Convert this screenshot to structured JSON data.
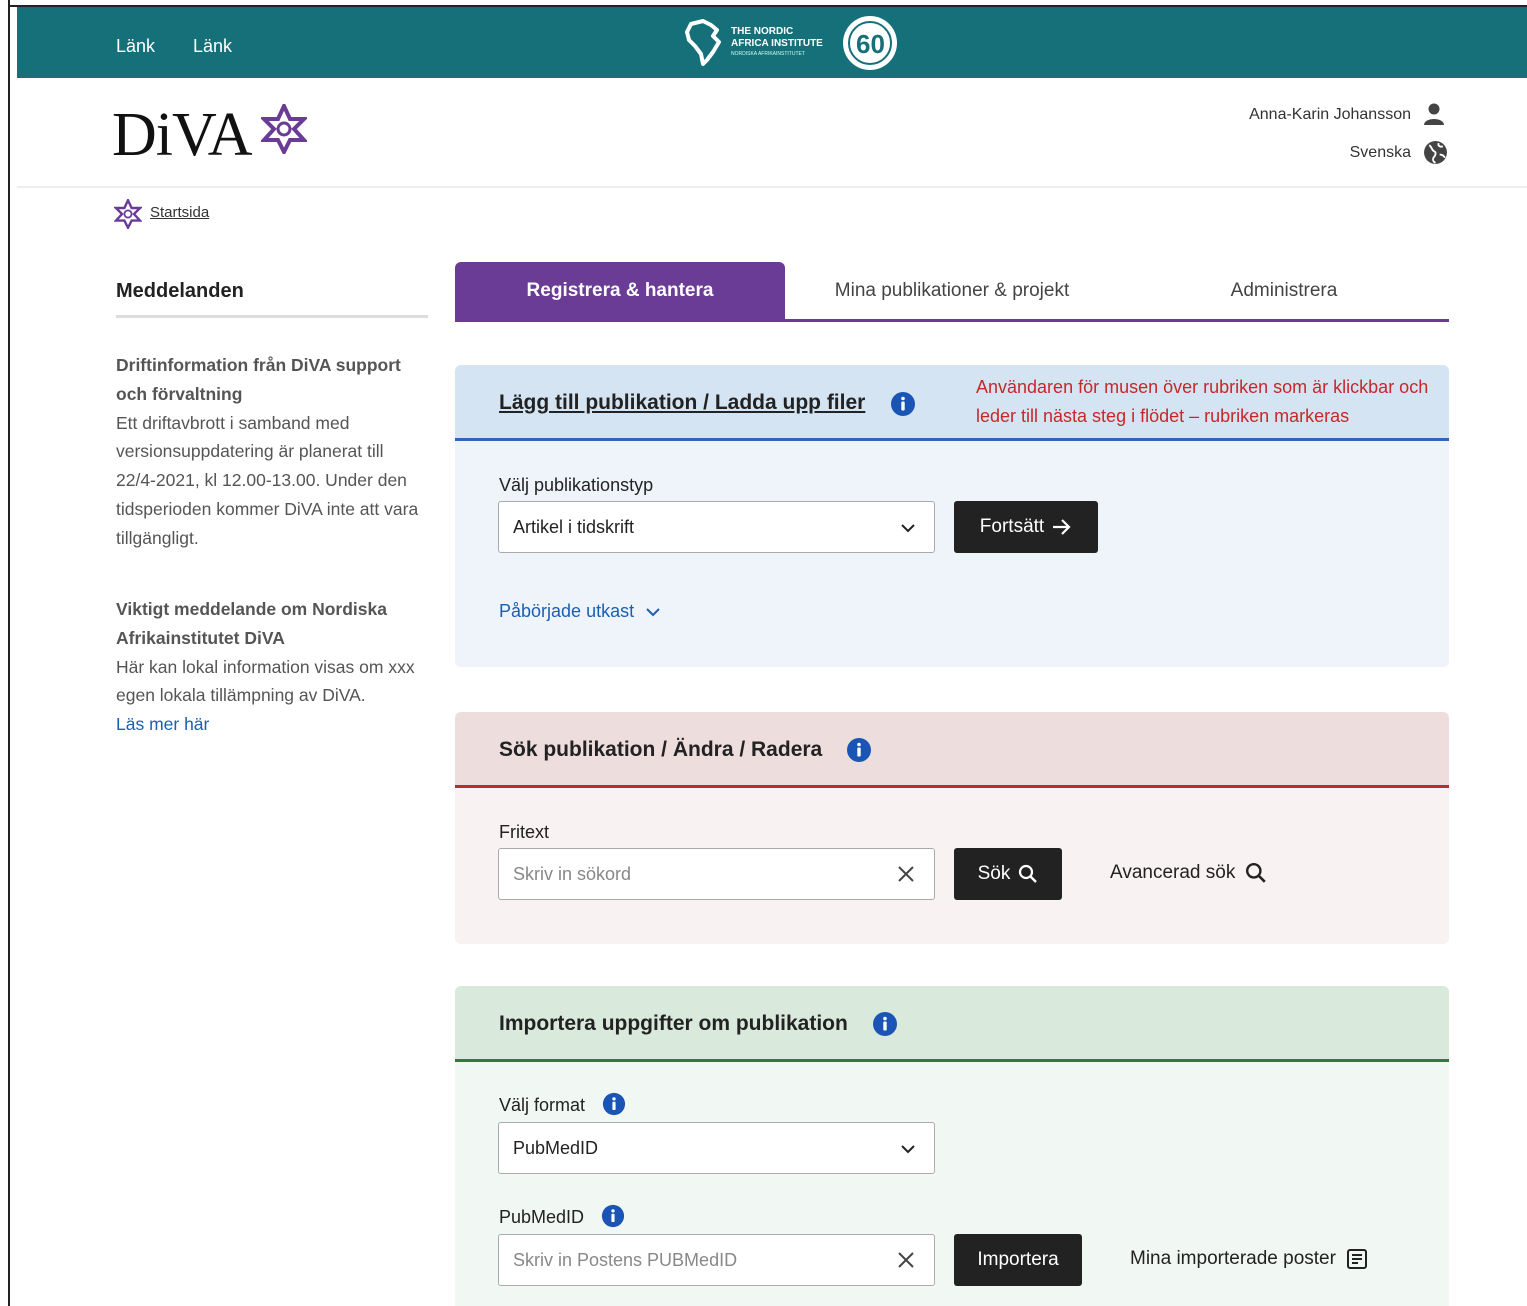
{
  "topbar": {
    "links": [
      "Länk",
      "Länk"
    ],
    "logo": {
      "line1": "THE NORDIC",
      "line2": "AFRICA INSTITUTE",
      "line3": "NORDISKA AFRIKAINSTITUTET",
      "badge": "60"
    }
  },
  "header": {
    "logo_text": "DiVA",
    "user_name": "Anna-Karin Johansson",
    "language": "Svenska"
  },
  "breadcrumb": {
    "home": "Startsida"
  },
  "sidebar": {
    "title": "Meddelanden",
    "messages": [
      {
        "heading": "Driftinformation från DiVA support och förvaltning",
        "body": "Ett driftavbrott i samband med versionsuppdatering är planerat till 22/4-2021, kl 12.00-13.00. Under den tidsperioden kommer DiVA inte att vara tillgängligt."
      },
      {
        "heading": "Viktigt meddelande om Nordiska Afrikainstitutet DiVA",
        "body": "Här kan lokal information visas om xxx egen lokala tillämpning av DiVA.",
        "link": "Läs mer här"
      }
    ]
  },
  "tabs": [
    {
      "label": "Registrera & hantera",
      "active": true
    },
    {
      "label": "Mina publikationer & projekt",
      "active": false
    },
    {
      "label": "Administrera",
      "active": false
    }
  ],
  "add_panel": {
    "title": "Lägg till publikation / Ladda upp filer",
    "annotation": "Användaren för musen över rubriken som är klickbar och leder till nästa steg i flödet – rubriken markeras",
    "type_label": "Välj publikationstyp",
    "type_value": "Artikel i tidskrift",
    "continue_label": "Fortsätt",
    "drafts_label": "Påbörjade utkast"
  },
  "search_panel": {
    "title": "Sök publikation / Ändra / Radera",
    "freetext_label": "Fritext",
    "freetext_placeholder": "Skriv in sökord",
    "search_label": "Sök",
    "advanced_label": "Avancerad sök"
  },
  "import_panel": {
    "title": "Importera uppgifter om publikation",
    "format_label": "Välj format",
    "format_value": "PubMedID",
    "id_label": "PubMedID",
    "id_placeholder": "Skriv in Postens PUBMedID",
    "import_label": "Importera",
    "my_imports_label": "Mina importerade poster"
  },
  "colors": {
    "teal": "#16707a",
    "purple": "#6b3c96",
    "blue_accent": "#2f66b5",
    "red_accent": "#b92c2c",
    "green_accent": "#2e7d32",
    "annotation_red": "#c62828"
  },
  "icons": [
    "user-icon",
    "globe-icon",
    "star-icon",
    "info-icon",
    "chevron-down-icon",
    "arrow-right-icon",
    "close-icon",
    "search-icon",
    "document-icon"
  ]
}
